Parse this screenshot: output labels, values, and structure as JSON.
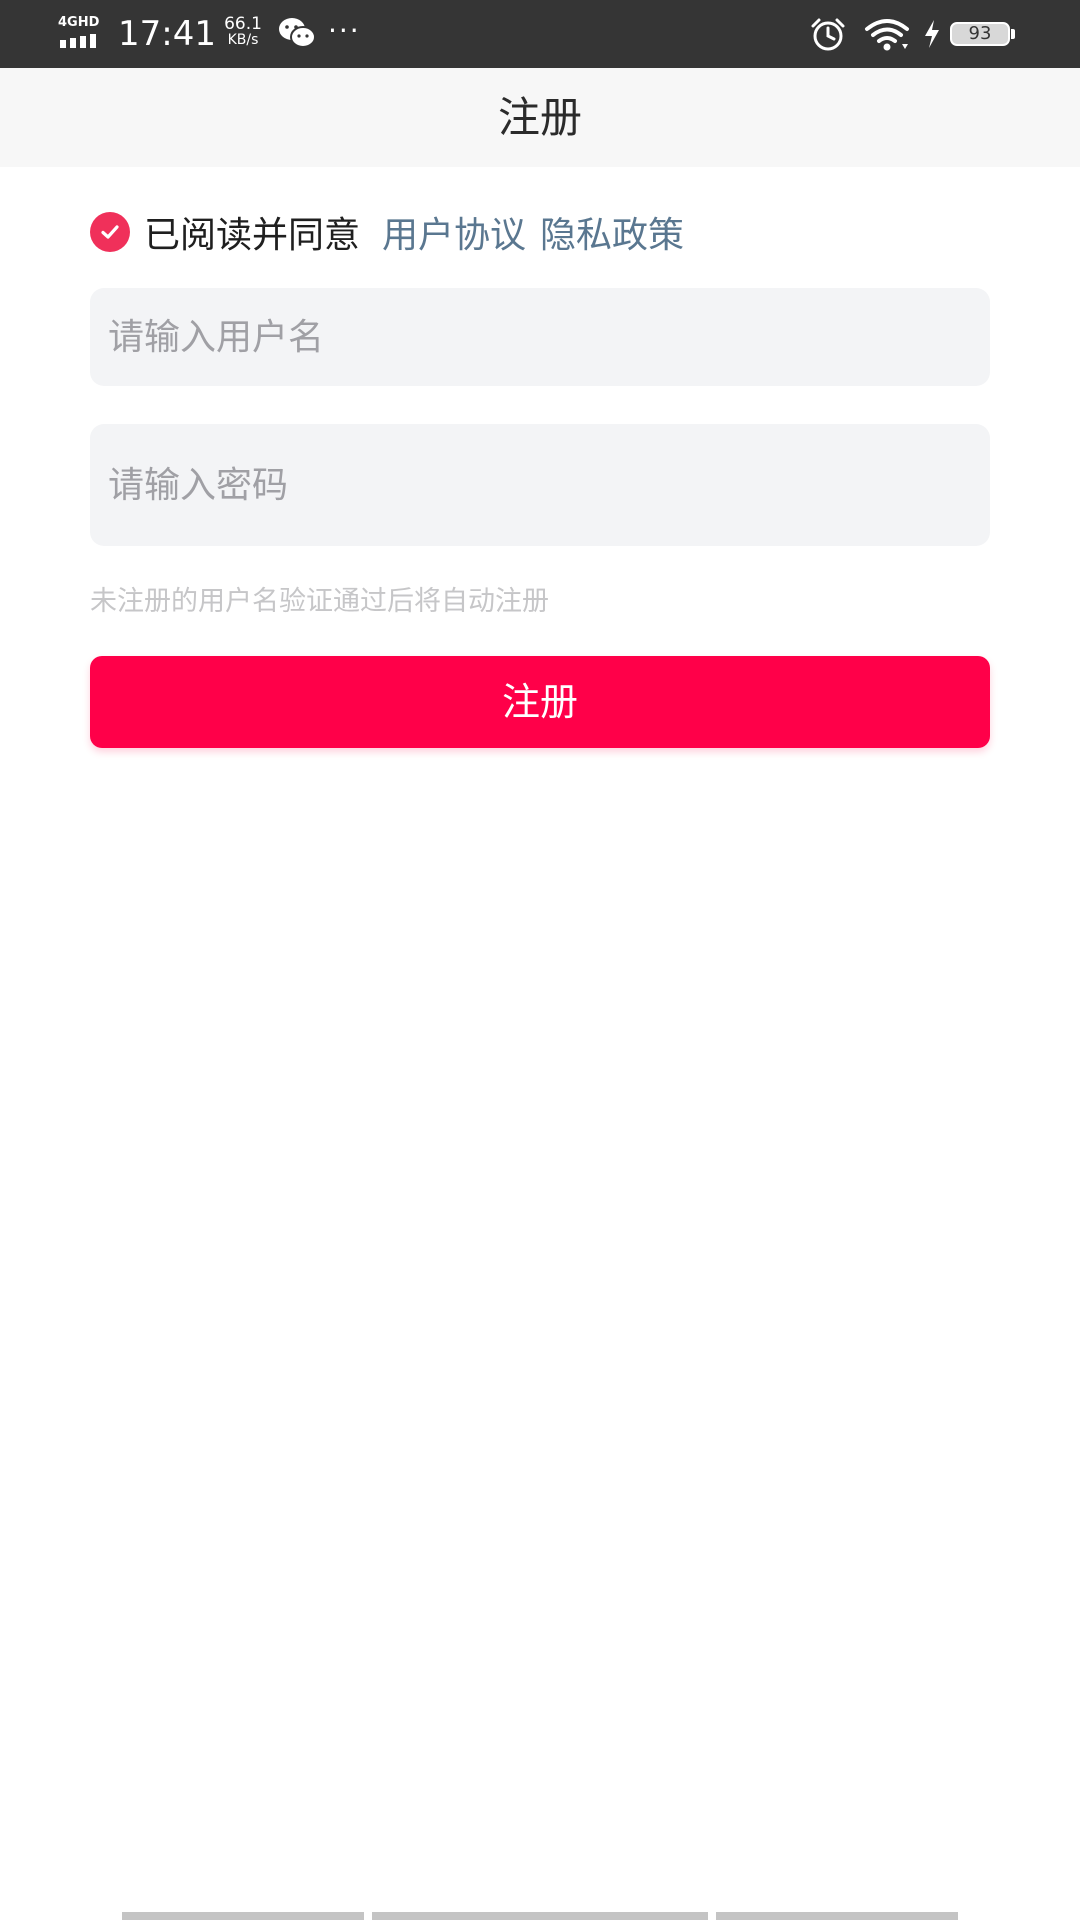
{
  "status_bar": {
    "network": "4GHD",
    "time": "17:41",
    "speed_value": "66.1",
    "speed_unit": "KB/s",
    "more": "···",
    "battery": "93",
    "icons": [
      "signal-icon",
      "wechat-icon",
      "alarm-icon",
      "wifi-icon",
      "charging-icon",
      "battery-icon"
    ]
  },
  "header": {
    "title": "注册"
  },
  "agreement": {
    "checked": true,
    "text": "已阅读并同意",
    "user_agreement": "用户协议",
    "privacy_policy": "隐私政策"
  },
  "form": {
    "username_placeholder": "请输入用户名",
    "password_placeholder": "请输入密码",
    "hint": "未注册的用户名验证通过后将自动注册",
    "submit_label": "注册"
  },
  "colors": {
    "status_bar_bg": "#353535",
    "header_bg": "#f7f7f7",
    "accent": "#ff0049",
    "check": "#f0305a",
    "link": "#5a7790",
    "input_bg": "#f3f4f6"
  }
}
